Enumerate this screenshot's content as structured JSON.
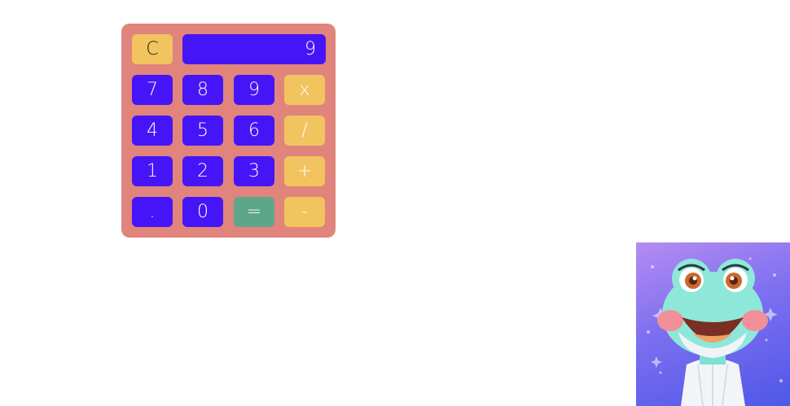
{
  "colors": {
    "panel": "#e0847c",
    "display": "#4615f7",
    "number_key": "#4615f7",
    "operator_key": "#f2c460",
    "clear_key": "#f2c460",
    "equals_key": "#5ea68a"
  },
  "calculator": {
    "display_value": "9",
    "keys": {
      "clear": "C",
      "seven": "7",
      "eight": "8",
      "nine": "9",
      "multiply": "x",
      "four": "4",
      "five": "5",
      "six": "6",
      "divide": "/",
      "one": "1",
      "two": "2",
      "three": "3",
      "add": "+",
      "decimal": ".",
      "zero": "0",
      "equals": "=",
      "subtract": "-"
    }
  },
  "avatar": {
    "icon": "frog-character-avatar"
  }
}
